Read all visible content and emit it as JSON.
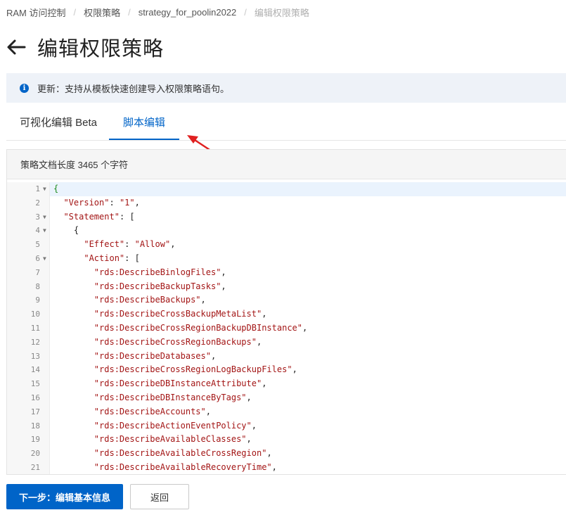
{
  "breadcrumb": [
    "RAM 访问控制",
    "权限策略",
    "strategy_for_poolin2022",
    "编辑权限策略"
  ],
  "page_title": "编辑权限策略",
  "notice": {
    "text": "更新：支持从模板快速创建导入权限策略语句。",
    "icon": "info-icon"
  },
  "tabs": {
    "visual": "可视化编辑 Beta",
    "script": "脚本编辑",
    "active": "script"
  },
  "editor": {
    "header": "策略文档长度 3465 个字符",
    "lines": [
      {
        "n": "1",
        "fold": true,
        "indent": "",
        "key": "",
        "val": "{",
        "suffix": ""
      },
      {
        "n": "2",
        "fold": false,
        "indent": "  ",
        "key": "\"Version\"",
        "val": "\"1\"",
        "suffix": ","
      },
      {
        "n": "3",
        "fold": true,
        "indent": "  ",
        "key": "\"Statement\"",
        "val": "[",
        "suffix": ""
      },
      {
        "n": "4",
        "fold": true,
        "indent": "    ",
        "key": "",
        "val": "{",
        "suffix": ""
      },
      {
        "n": "5",
        "fold": false,
        "indent": "      ",
        "key": "\"Effect\"",
        "val": "\"Allow\"",
        "suffix": ","
      },
      {
        "n": "6",
        "fold": true,
        "indent": "      ",
        "key": "\"Action\"",
        "val": "[",
        "suffix": ""
      },
      {
        "n": "7",
        "fold": false,
        "indent": "        ",
        "key": "",
        "val": "\"rds:DescribeBinlogFiles\"",
        "suffix": ","
      },
      {
        "n": "8",
        "fold": false,
        "indent": "        ",
        "key": "",
        "val": "\"rds:DescribeBackupTasks\"",
        "suffix": ","
      },
      {
        "n": "9",
        "fold": false,
        "indent": "        ",
        "key": "",
        "val": "\"rds:DescribeBackups\"",
        "suffix": ","
      },
      {
        "n": "10",
        "fold": false,
        "indent": "        ",
        "key": "",
        "val": "\"rds:DescribeCrossBackupMetaList\"",
        "suffix": ","
      },
      {
        "n": "11",
        "fold": false,
        "indent": "        ",
        "key": "",
        "val": "\"rds:DescribeCrossRegionBackupDBInstance\"",
        "suffix": ","
      },
      {
        "n": "12",
        "fold": false,
        "indent": "        ",
        "key": "",
        "val": "\"rds:DescribeCrossRegionBackups\"",
        "suffix": ","
      },
      {
        "n": "13",
        "fold": false,
        "indent": "        ",
        "key": "",
        "val": "\"rds:DescribeDatabases\"",
        "suffix": ","
      },
      {
        "n": "14",
        "fold": false,
        "indent": "        ",
        "key": "",
        "val": "\"rds:DescribeCrossRegionLogBackupFiles\"",
        "suffix": ","
      },
      {
        "n": "15",
        "fold": false,
        "indent": "        ",
        "key": "",
        "val": "\"rds:DescribeDBInstanceAttribute\"",
        "suffix": ","
      },
      {
        "n": "16",
        "fold": false,
        "indent": "        ",
        "key": "",
        "val": "\"rds:DescribeDBInstanceByTags\"",
        "suffix": ","
      },
      {
        "n": "17",
        "fold": false,
        "indent": "        ",
        "key": "",
        "val": "\"rds:DescribeAccounts\"",
        "suffix": ","
      },
      {
        "n": "18",
        "fold": false,
        "indent": "        ",
        "key": "",
        "val": "\"rds:DescribeActionEventPolicy\"",
        "suffix": ","
      },
      {
        "n": "19",
        "fold": false,
        "indent": "        ",
        "key": "",
        "val": "\"rds:DescribeAvailableClasses\"",
        "suffix": ","
      },
      {
        "n": "20",
        "fold": false,
        "indent": "        ",
        "key": "",
        "val": "\"rds:DescribeAvailableCrossRegion\"",
        "suffix": ","
      },
      {
        "n": "21",
        "fold": false,
        "indent": "        ",
        "key": "",
        "val": "\"rds:DescribeAvailableRecoveryTime\"",
        "suffix": ","
      }
    ]
  },
  "footer": {
    "next": "下一步：编辑基本信息",
    "back": "返回"
  },
  "colors": {
    "accent": "#0064c8",
    "string": "#a31515",
    "annotation_arrow": "#e02020"
  }
}
